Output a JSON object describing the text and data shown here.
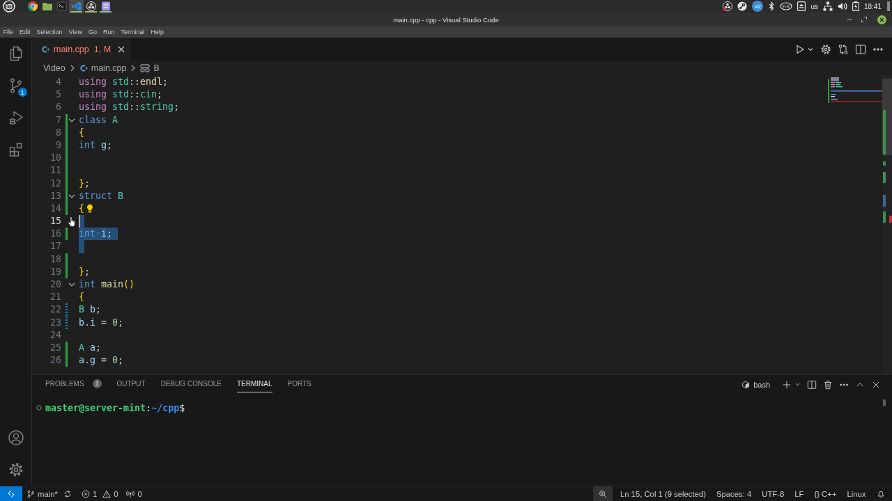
{
  "system_panel": {
    "launchers": [
      {
        "kind": "browser",
        "running": false,
        "selected": false
      },
      {
        "kind": "files",
        "running": false,
        "selected": false
      },
      {
        "kind": "terminal",
        "running": false,
        "selected": false
      },
      {
        "kind": "code-editor",
        "running": true,
        "selected": true
      },
      {
        "kind": "recorder",
        "running": true,
        "selected": false
      },
      {
        "kind": "notes",
        "running": true,
        "selected": false
      }
    ],
    "tray": {
      "updates_count": "42",
      "keyboard_layout": "us",
      "clock": "18:41"
    }
  },
  "window": {
    "title": "main.cpp - cpp - Visual Studio Code"
  },
  "menu": [
    "File",
    "Edit",
    "Selection",
    "View",
    "Go",
    "Run",
    "Terminal",
    "Help"
  ],
  "activity_bar": {
    "items": [
      {
        "kind": "explorer"
      },
      {
        "kind": "source-control",
        "badge": "1"
      },
      {
        "kind": "run-debug"
      },
      {
        "kind": "extensions"
      }
    ],
    "bottom_items": [
      {
        "kind": "accounts"
      },
      {
        "kind": "manage"
      }
    ]
  },
  "editor": {
    "tabs": [
      {
        "label": "main.cpp",
        "badge": "1, M",
        "selected": true,
        "has_problems": true
      }
    ],
    "breadcrumbs": [
      {
        "kind": "folder",
        "label": "Video"
      },
      {
        "kind": "file",
        "label": "main.cpp"
      },
      {
        "kind": "struct",
        "label": "B"
      }
    ],
    "lines": [
      {
        "number": "4",
        "kind": "unchanged",
        "tokens": [
          {
            "text": "using",
            "kind": "keyword-control"
          },
          {
            "text": " std",
            "kind": "type"
          },
          {
            "text": "::",
            "kind": "punctuation"
          },
          {
            "text": "endl",
            "kind": "function"
          },
          {
            "text": ";",
            "kind": "punctuation"
          }
        ],
        "foldable": false,
        "selected": false,
        "current": false
      },
      {
        "number": "5",
        "kind": "unchanged",
        "tokens": [
          {
            "text": "using",
            "kind": "keyword-control"
          },
          {
            "text": " std",
            "kind": "type"
          },
          {
            "text": "::",
            "kind": "punctuation"
          },
          {
            "text": "cin",
            "kind": "type"
          },
          {
            "text": ";",
            "kind": "punctuation"
          }
        ],
        "foldable": false,
        "selected": false,
        "current": false
      },
      {
        "number": "6",
        "kind": "unchanged",
        "tokens": [
          {
            "text": "using",
            "kind": "keyword-control"
          },
          {
            "text": " std",
            "kind": "type"
          },
          {
            "text": "::",
            "kind": "punctuation"
          },
          {
            "text": "string",
            "kind": "type"
          },
          {
            "text": ";",
            "kind": "punctuation"
          }
        ],
        "foldable": false,
        "selected": false,
        "current": false
      },
      {
        "number": "7",
        "kind": "added",
        "tokens": [
          {
            "text": "class",
            "kind": "keyword"
          },
          {
            "text": " A",
            "kind": "type"
          }
        ],
        "foldable": true,
        "selected": false,
        "current": false
      },
      {
        "number": "8",
        "kind": "added",
        "tokens": [
          {
            "text": "{",
            "kind": "bracket"
          }
        ],
        "foldable": false,
        "selected": false,
        "current": false
      },
      {
        "number": "9",
        "kind": "added",
        "tokens": [
          {
            "text": "int",
            "kind": "keyword"
          },
          {
            "text": " g",
            "kind": "variable"
          },
          {
            "text": ";",
            "kind": "punctuation"
          }
        ],
        "foldable": false,
        "selected": false,
        "current": false
      },
      {
        "number": "10",
        "kind": "added",
        "foldable": false,
        "selected": false,
        "current": false
      },
      {
        "number": "11",
        "kind": "added",
        "foldable": false,
        "selected": false,
        "current": false
      },
      {
        "number": "12",
        "kind": "added",
        "tokens": [
          {
            "text": "}",
            "kind": "bracket"
          },
          {
            "text": ";",
            "kind": "punctuation"
          }
        ],
        "foldable": false,
        "selected": false,
        "current": false
      },
      {
        "number": "13",
        "kind": "added",
        "tokens": [
          {
            "text": "struct",
            "kind": "keyword"
          },
          {
            "text": " B",
            "kind": "type"
          }
        ],
        "foldable": true,
        "selected": false,
        "current": false
      },
      {
        "number": "14",
        "kind": "added",
        "tokens": [
          {
            "text": "{",
            "kind": "bracket"
          },
          {
            "kind": "lightbulb"
          }
        ],
        "foldable": false,
        "selected": false,
        "current": false
      },
      {
        "number": "15",
        "kind": "unchanged",
        "foldable": false,
        "selected": true,
        "current": true
      },
      {
        "number": "16",
        "kind": "added",
        "tokens": [
          {
            "text": "int",
            "kind": "keyword"
          },
          {
            "text": "·",
            "kind": "whitespace"
          },
          {
            "text": "i",
            "kind": "variable"
          },
          {
            "text": ";",
            "kind": "punctuation"
          }
        ],
        "foldable": false,
        "selected": true,
        "current": false
      },
      {
        "number": "17",
        "kind": "unchanged",
        "foldable": false,
        "selected": true,
        "current": false
      },
      {
        "number": "18",
        "kind": "added",
        "foldable": false,
        "selected": false,
        "current": false
      },
      {
        "number": "19",
        "kind": "added",
        "tokens": [
          {
            "text": "}",
            "kind": "bracket"
          },
          {
            "text": ";",
            "kind": "punctuation"
          }
        ],
        "foldable": false,
        "selected": false,
        "current": false
      },
      {
        "number": "20",
        "kind": "unchanged",
        "tokens": [
          {
            "text": "int",
            "kind": "keyword"
          },
          {
            "text": " main",
            "kind": "function"
          },
          {
            "text": "()",
            "kind": "bracket"
          }
        ],
        "foldable": true,
        "selected": false,
        "current": false
      },
      {
        "number": "21",
        "kind": "unchanged",
        "tokens": [
          {
            "text": "{",
            "kind": "bracket"
          }
        ],
        "foldable": false,
        "selected": false,
        "current": false
      },
      {
        "number": "22",
        "kind": "modified",
        "tokens": [
          {
            "text": "B",
            "kind": "type"
          },
          {
            "text": " b",
            "kind": "variable"
          },
          {
            "text": ";",
            "kind": "punctuation"
          }
        ],
        "foldable": false,
        "selected": false,
        "current": false
      },
      {
        "number": "23",
        "kind": "modified",
        "tokens": [
          {
            "text": "b",
            "kind": "variable"
          },
          {
            "text": ".",
            "kind": "punctuation"
          },
          {
            "text": "i",
            "kind": "variable"
          },
          {
            "text": " =",
            "kind": "punctuation"
          },
          {
            "text": " 0",
            "kind": "number"
          },
          {
            "text": ";",
            "kind": "punctuation"
          }
        ],
        "foldable": false,
        "selected": false,
        "current": false
      },
      {
        "number": "24",
        "kind": "unchanged",
        "foldable": false,
        "selected": false,
        "current": false
      },
      {
        "number": "25",
        "kind": "added",
        "tokens": [
          {
            "text": "A",
            "kind": "type"
          },
          {
            "text": " a",
            "kind": "variable"
          },
          {
            "text": ";",
            "kind": "punctuation"
          }
        ],
        "foldable": false,
        "selected": false,
        "current": false
      },
      {
        "number": "26",
        "kind": "added",
        "tokens": [
          {
            "text": "a",
            "kind": "variable"
          },
          {
            "text": ".",
            "kind": "punctuation"
          },
          {
            "text": "g",
            "kind": "variable"
          },
          {
            "text": " =",
            "kind": "punctuation"
          },
          {
            "text": " 0",
            "kind": "number"
          },
          {
            "text": ";",
            "kind": "punctuation"
          }
        ],
        "foldable": false,
        "selected": false,
        "current": false
      }
    ]
  },
  "panel": {
    "tabs": [
      {
        "label": "PROBLEMS",
        "badge": "1",
        "selected": false
      },
      {
        "label": "OUTPUT",
        "selected": false
      },
      {
        "label": "DEBUG CONSOLE",
        "selected": false
      },
      {
        "label": "TERMINAL",
        "selected": true
      },
      {
        "label": "PORTS",
        "selected": false
      }
    ],
    "terminal_name": "bash",
    "terminal_lines": [
      {
        "parts": [
          {
            "kind": "user-host",
            "text": "master@server-mint"
          },
          {
            "kind": "separator",
            "text": ":"
          },
          {
            "kind": "path",
            "text": "~/cpp"
          },
          {
            "kind": "prompt",
            "text": "$"
          }
        ]
      }
    ]
  },
  "status_bar": {
    "left": [
      {
        "kind": "remote"
      },
      {
        "kind": "branch",
        "label": "main*"
      },
      {
        "kind": "sync"
      },
      {
        "kind": "problems",
        "errors": "1",
        "warnings": "0"
      },
      {
        "kind": "ports",
        "label": "0"
      }
    ],
    "right": [
      {
        "kind": "zoom",
        "highlighted": true
      },
      {
        "kind": "text",
        "label": "Ln 15, Col 1 (9 selected)"
      },
      {
        "kind": "text",
        "label": "Spaces: 4"
      },
      {
        "kind": "text",
        "label": "UTF-8"
      },
      {
        "kind": "text",
        "label": "LF"
      },
      {
        "kind": "language",
        "icon": "{}",
        "label": "C++"
      },
      {
        "kind": "text",
        "label": "Linux"
      },
      {
        "kind": "notifications"
      }
    ]
  }
}
